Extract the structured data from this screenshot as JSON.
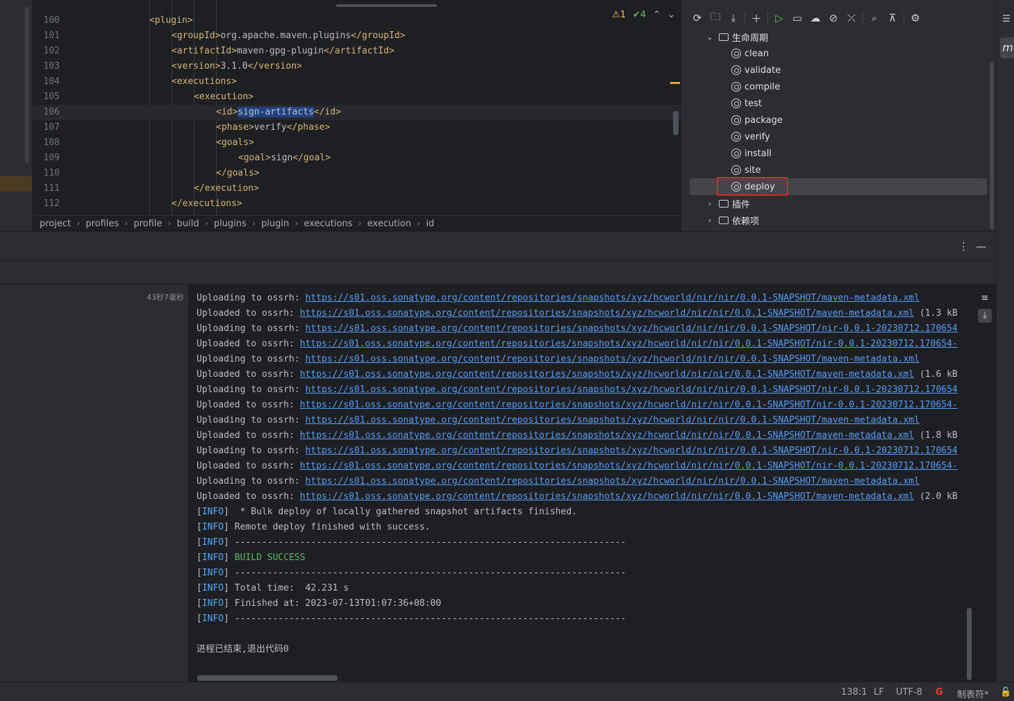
{
  "editor": {
    "problems": {
      "warnings": "1",
      "checks": "4"
    },
    "lines": [
      {
        "num": "100",
        "indent": 0,
        "parts": [
          {
            "t": "tag",
            "v": "<plugin>"
          }
        ]
      },
      {
        "num": "101",
        "indent": 1,
        "parts": [
          {
            "t": "tag",
            "v": "<groupId>"
          },
          {
            "t": "txt",
            "v": "org.apache.maven.plugins"
          },
          {
            "t": "tag",
            "v": "</groupId>"
          }
        ]
      },
      {
        "num": "102",
        "indent": 1,
        "parts": [
          {
            "t": "tag",
            "v": "<artifactId>"
          },
          {
            "t": "txt",
            "v": "maven-gpg-plugin"
          },
          {
            "t": "tag",
            "v": "</artifactId>"
          }
        ]
      },
      {
        "num": "103",
        "indent": 1,
        "parts": [
          {
            "t": "tag",
            "v": "<version>"
          },
          {
            "t": "txt",
            "v": "3.1.0"
          },
          {
            "t": "tag",
            "v": "</version>"
          }
        ]
      },
      {
        "num": "104",
        "indent": 1,
        "parts": [
          {
            "t": "tag",
            "v": "<executions>"
          }
        ]
      },
      {
        "num": "105",
        "indent": 2,
        "parts": [
          {
            "t": "tag",
            "v": "<execution>"
          }
        ]
      },
      {
        "num": "106",
        "indent": 3,
        "current": true,
        "parts": [
          {
            "t": "tag",
            "v": "<id>"
          },
          {
            "t": "sel",
            "v": "sign-artifacts"
          },
          {
            "t": "tag",
            "v": "</id>"
          }
        ]
      },
      {
        "num": "107",
        "indent": 3,
        "parts": [
          {
            "t": "tag",
            "v": "<phase>"
          },
          {
            "t": "txt",
            "v": "verify"
          },
          {
            "t": "tag",
            "v": "</phase>"
          }
        ]
      },
      {
        "num": "108",
        "indent": 3,
        "parts": [
          {
            "t": "tag",
            "v": "<goals>"
          }
        ]
      },
      {
        "num": "109",
        "indent": 4,
        "parts": [
          {
            "t": "tag",
            "v": "<goal>"
          },
          {
            "t": "txt",
            "v": "sign"
          },
          {
            "t": "tag",
            "v": "</goal>"
          }
        ]
      },
      {
        "num": "110",
        "indent": 3,
        "parts": [
          {
            "t": "tag",
            "v": "</goals>"
          }
        ]
      },
      {
        "num": "111",
        "indent": 2,
        "parts": [
          {
            "t": "tag",
            "v": "</execution>"
          }
        ]
      },
      {
        "num": "112",
        "indent": 1,
        "parts": [
          {
            "t": "tag",
            "v": "</executions>"
          }
        ]
      }
    ]
  },
  "breadcrumb": [
    "project",
    "profiles",
    "profile",
    "build",
    "plugins",
    "plugin",
    "executions",
    "execution",
    "id"
  ],
  "maven": {
    "lifecycle_label": "生命周期",
    "phases": [
      "clean",
      "validate",
      "compile",
      "test",
      "package",
      "verify",
      "install",
      "site",
      "deploy"
    ],
    "selected_phase": "deploy",
    "plugins_label": "插件",
    "dependencies_label": "依赖项"
  },
  "run": {
    "elapsed": "43秒7毫秒",
    "console": [
      {
        "kind": "link",
        "prefix": "Uploading to ossrh: ",
        "url": "https://s01.oss.sonatype.org/content/repositories/snapshots/xyz/hcworld/nir/nir/0.0.1-SNAPSHOT/maven-metadata.xml",
        "suffix": ""
      },
      {
        "kind": "link",
        "prefix": "Uploaded to ossrh: ",
        "url": "https://s01.oss.sonatype.org/content/repositories/snapshots/xyz/hcworld/nir/nir/0.0.1-SNAPSHOT/maven-metadata.xml",
        "suffix": " (1.3 kB"
      },
      {
        "kind": "link",
        "prefix": "Uploading to ossrh: ",
        "url": "https://s01.oss.sonatype.org/content/repositories/snapshots/xyz/hcworld/nir/nir/0.0.1-SNAPSHOT/nir-0.0.1-20230712.170654",
        "suffix": ""
      },
      {
        "kind": "link",
        "prefix": "Uploaded to ossrh: ",
        "url": "https://s01.oss.sonatype.org/content/repositories/snapshots/xyz/hcworld/nir/nir/0.0.1-SNAPSHOT/nir-0.0.1-20230712.170654-",
        "suffix": ""
      },
      {
        "kind": "link",
        "prefix": "Uploading to ossrh: ",
        "url": "https://s01.oss.sonatype.org/content/repositories/snapshots/xyz/hcworld/nir/nir/0.0.1-SNAPSHOT/maven-metadata.xml",
        "suffix": ""
      },
      {
        "kind": "link",
        "prefix": "Uploaded to ossrh: ",
        "url": "https://s01.oss.sonatype.org/content/repositories/snapshots/xyz/hcworld/nir/nir/0.0.1-SNAPSHOT/maven-metadata.xml",
        "suffix": " (1.6 kB"
      },
      {
        "kind": "link",
        "prefix": "Uploading to ossrh: ",
        "url": "https://s01.oss.sonatype.org/content/repositories/snapshots/xyz/hcworld/nir/nir/0.0.1-SNAPSHOT/nir-0.0.1-20230712.170654",
        "suffix": ""
      },
      {
        "kind": "link",
        "prefix": "Uploaded to ossrh: ",
        "url": "https://s01.oss.sonatype.org/content/repositories/snapshots/xyz/hcworld/nir/nir/0.0.1-SNAPSHOT/nir-0.0.1-20230712.170654-",
        "suffix": ""
      },
      {
        "kind": "link",
        "prefix": "Uploading to ossrh: ",
        "url": "https://s01.oss.sonatype.org/content/repositories/snapshots/xyz/hcworld/nir/nir/0.0.1-SNAPSHOT/maven-metadata.xml",
        "suffix": ""
      },
      {
        "kind": "link",
        "prefix": "Uploaded to ossrh: ",
        "url": "https://s01.oss.sonatype.org/content/repositories/snapshots/xyz/hcworld/nir/nir/0.0.1-SNAPSHOT/maven-metadata.xml",
        "suffix": " (1.8 kB"
      },
      {
        "kind": "link",
        "prefix": "Uploading to ossrh: ",
        "url": "https://s01.oss.sonatype.org/content/repositories/snapshots/xyz/hcworld/nir/nir/0.0.1-SNAPSHOT/nir-0.0.1-20230712.170654",
        "suffix": ""
      },
      {
        "kind": "link",
        "prefix": "Uploaded to ossrh: ",
        "url": "https://s01.oss.sonatype.org/content/repositories/snapshots/xyz/hcworld/nir/nir/0.0.1-SNAPSHOT/nir-0.0.1-20230712.170654-",
        "suffix": ""
      },
      {
        "kind": "link",
        "prefix": "Uploading to ossrh: ",
        "url": "https://s01.oss.sonatype.org/content/repositories/snapshots/xyz/hcworld/nir/nir/0.0.1-SNAPSHOT/maven-metadata.xml",
        "suffix": ""
      },
      {
        "kind": "link",
        "prefix": "Uploaded to ossrh: ",
        "url": "https://s01.oss.sonatype.org/content/repositories/snapshots/xyz/hcworld/nir/nir/0.0.1-SNAPSHOT/maven-metadata.xml",
        "suffix": " (2.0 kB"
      },
      {
        "kind": "info",
        "text": " * Bulk deploy of locally gathered snapshot artifacts finished."
      },
      {
        "kind": "info",
        "text": "Remote deploy finished with success."
      },
      {
        "kind": "info",
        "text": "------------------------------------------------------------------------"
      },
      {
        "kind": "success",
        "text": "BUILD SUCCESS"
      },
      {
        "kind": "info",
        "text": "------------------------------------------------------------------------"
      },
      {
        "kind": "info",
        "text": "Total time:  42.231 s"
      },
      {
        "kind": "info",
        "text": "Finished at: 2023-07-13T01:07:36+08:00"
      },
      {
        "kind": "info",
        "text": "------------------------------------------------------------------------"
      },
      {
        "kind": "blank",
        "text": ""
      },
      {
        "kind": "plain",
        "text": "进程已结束,退出代码0"
      }
    ],
    "info_tag": "INFO"
  },
  "status": {
    "position": "138:1",
    "line_sep": "LF",
    "encoding": "UTF-8",
    "indent": "制表符*"
  }
}
